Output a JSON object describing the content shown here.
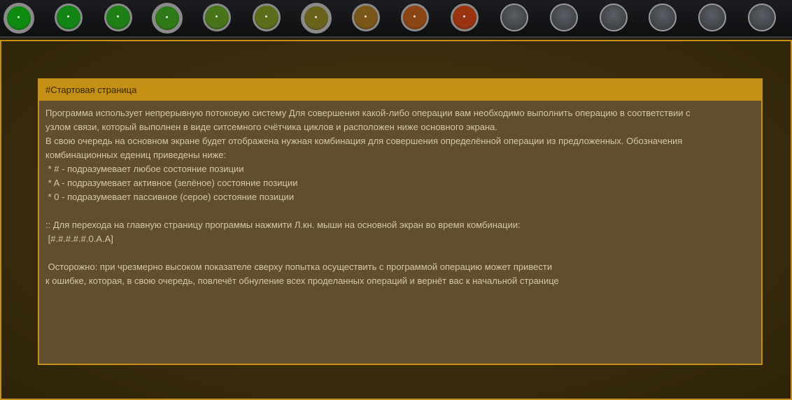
{
  "leds": [
    {
      "name": "led-1",
      "color": "#0f8a10",
      "state": "on"
    },
    {
      "name": "led-2",
      "color": "#128515",
      "state": "on"
    },
    {
      "name": "led-3",
      "color": "#1f7f17",
      "state": "on"
    },
    {
      "name": "led-4",
      "color": "#2f7a18",
      "state": "on"
    },
    {
      "name": "led-5",
      "color": "#48741a",
      "state": "on"
    },
    {
      "name": "led-6",
      "color": "#5a6e1c",
      "state": "on"
    },
    {
      "name": "led-7",
      "color": "#6a631c",
      "state": "on"
    },
    {
      "name": "led-8",
      "color": "#7a5618",
      "state": "on"
    },
    {
      "name": "led-9",
      "color": "#8c4514",
      "state": "on"
    },
    {
      "name": "led-10",
      "color": "#9a3410",
      "state": "on"
    },
    {
      "name": "led-11",
      "color": "#4a4d52",
      "state": "off"
    },
    {
      "name": "led-12",
      "color": "#4a4d52",
      "state": "off"
    },
    {
      "name": "led-13",
      "color": "#4a4d52",
      "state": "off"
    },
    {
      "name": "led-14",
      "color": "#4a4d52",
      "state": "off"
    },
    {
      "name": "led-15",
      "color": "#4a4d52",
      "state": "off"
    },
    {
      "name": "led-16",
      "color": "#4a4d52",
      "state": "off"
    }
  ],
  "window": {
    "title": "#Стартовая страница",
    "lines": [
      "Программа использует непрерывную потоковую систему Для совершения какой-либо операции вам необходимо выполнить операцию в соответствии с",
      "узлом связи, который выполнен в виде ситсемного счётчика циклов и расположен ниже основного экрана.",
      "В свою очередь на основном экране будет отображена нужная комбинация для совершения определённой операции из предложенных. Обозначения",
      "комбинационных едениц приведены ниже:",
      " * # - подразумевает любое состояние позиции",
      " * A - подразумевает активное (зелёное) состояние позиции",
      " * 0 - подразумевает пассивное (серое) состояние позиции",
      "",
      ":: Для перехода на главную страницу программы нажмити Л.кн. мыши на основной экран во время комбинации:",
      " [#.#.#.#.#.0.A.A]",
      "",
      " Осторожно: при чрезмерно высоком показателе сверху попытка осуществить с программой операцию может привести",
      "к ошибке, которая, в свою очередь, повлечёт обнуление всех проделанных операций и вернёт вас к начальной странице"
    ]
  }
}
